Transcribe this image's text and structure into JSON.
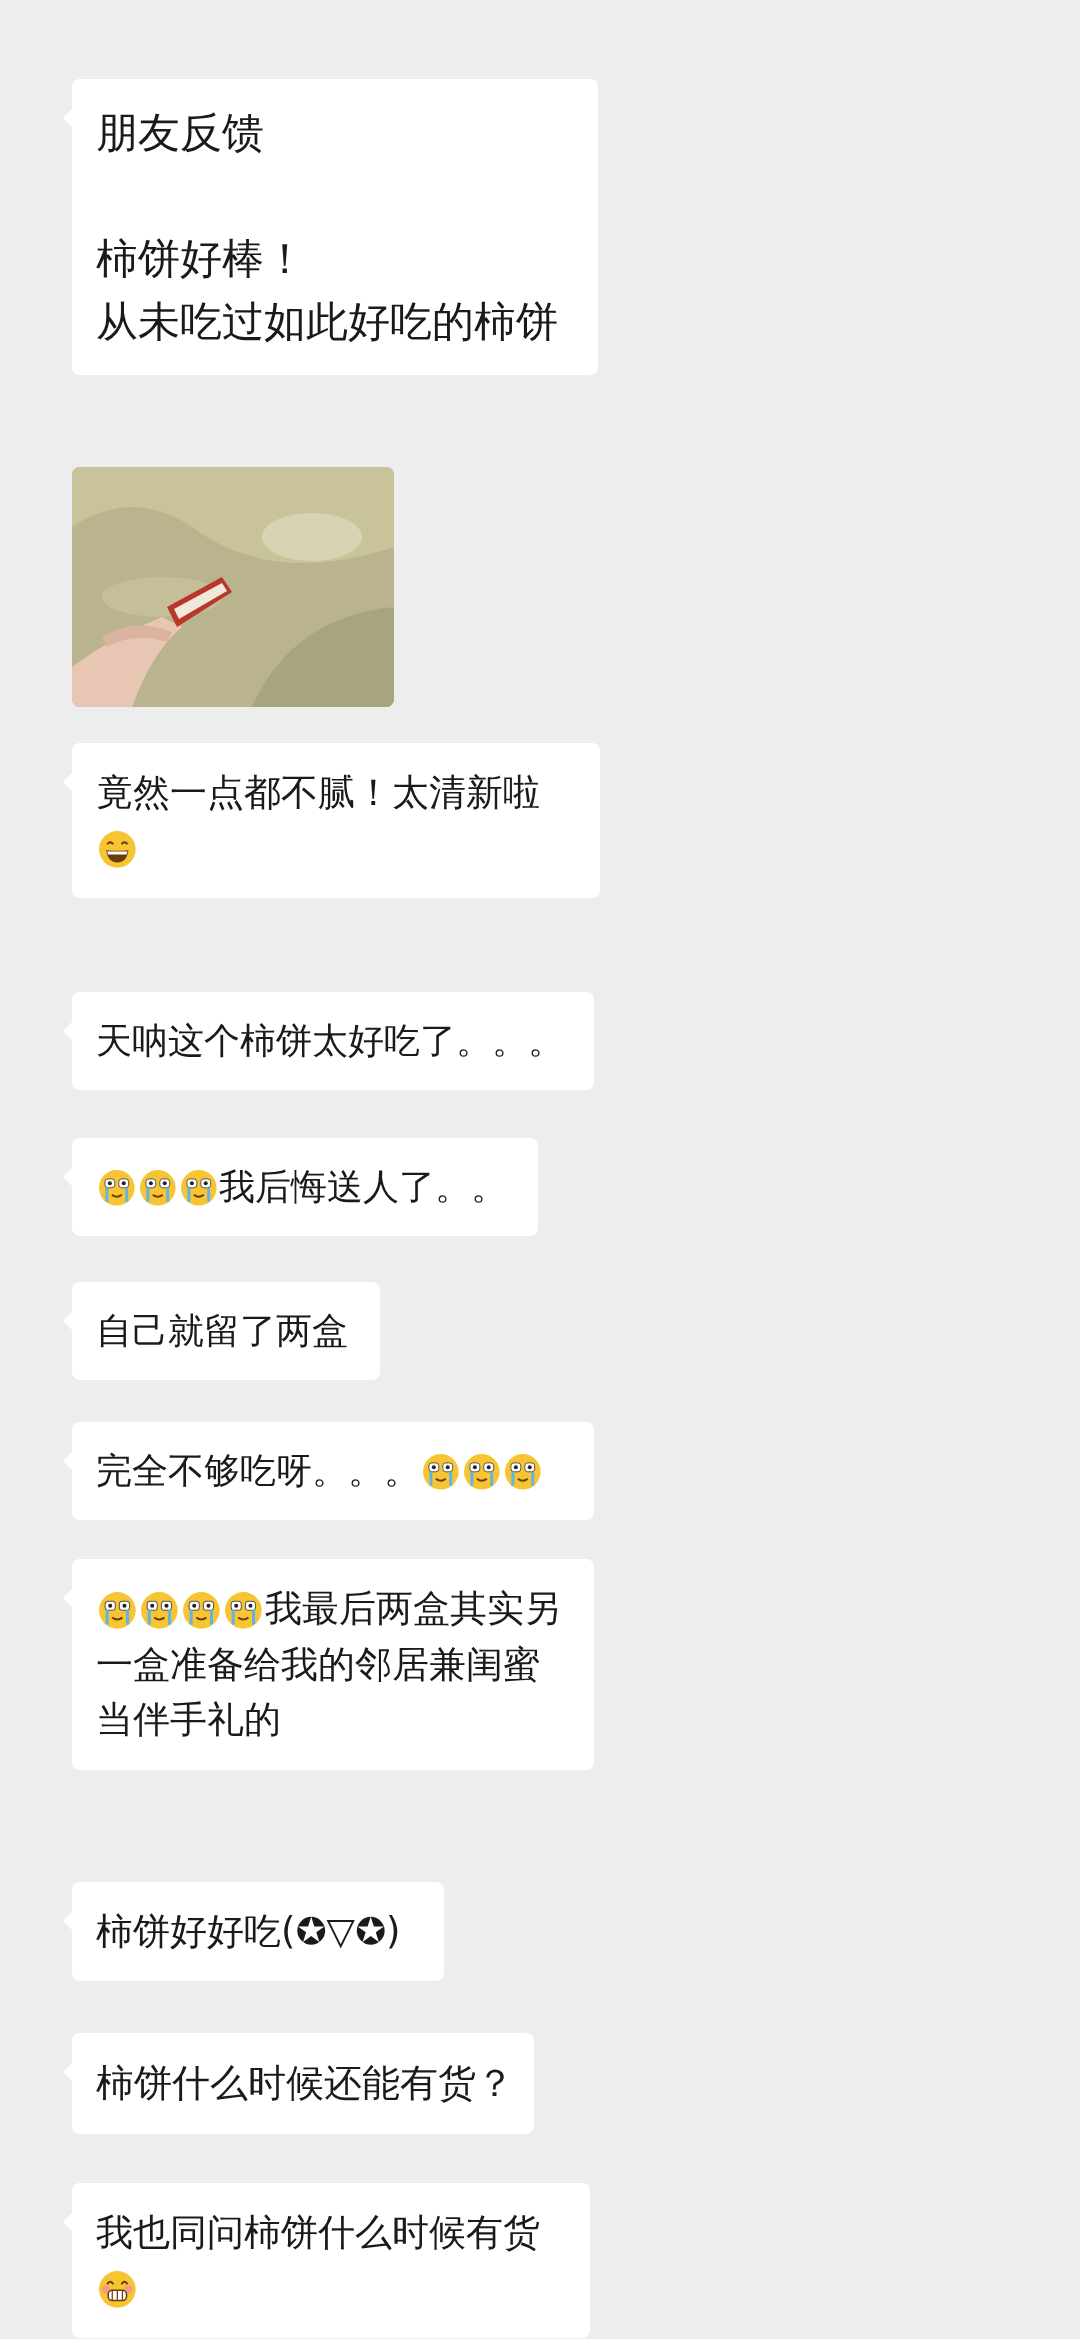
{
  "messages": [
    {
      "kind": "text",
      "parts": [
        {
          "kind": "heading",
          "text": "朋友反馈"
        },
        {
          "kind": "line",
          "text": "柿饼好棒！"
        },
        {
          "kind": "line",
          "text": "从未吃过如此好吃的柿饼"
        }
      ]
    },
    {
      "kind": "picture"
    },
    {
      "kind": "text",
      "parts": [
        {
          "kind": "text",
          "text": "竟然一点都不腻！太清新啦"
        },
        {
          "kind": "grinning"
        }
      ]
    },
    {
      "kind": "text",
      "parts": [
        {
          "kind": "text",
          "text": "天呐这个柿饼太好吃了。。。"
        }
      ]
    },
    {
      "kind": "text",
      "parts": [
        {
          "kind": "crying"
        },
        {
          "kind": "crying"
        },
        {
          "kind": "crying"
        },
        {
          "kind": "text",
          "text": "我后悔送人了。。"
        }
      ]
    },
    {
      "kind": "text",
      "parts": [
        {
          "kind": "text",
          "text": "自己就留了两盒"
        }
      ]
    },
    {
      "kind": "text",
      "parts": [
        {
          "kind": "text",
          "text": "完全不够吃呀。。。"
        },
        {
          "kind": "crying"
        },
        {
          "kind": "crying"
        },
        {
          "kind": "crying"
        }
      ]
    },
    {
      "kind": "text",
      "parts": [
        {
          "kind": "crying"
        },
        {
          "kind": "crying"
        },
        {
          "kind": "crying"
        },
        {
          "kind": "crying"
        },
        {
          "kind": "text",
          "text": "我最后两盒其实另"
        },
        {
          "kind": "line",
          "text": "一盒准备给我的邻居兼闺蜜当伴手礼的"
        }
      ]
    },
    {
      "kind": "text",
      "parts": [
        {
          "kind": "text",
          "text": "柿饼好好吃(✪▽✪)"
        }
      ]
    },
    {
      "kind": "text",
      "parts": [
        {
          "kind": "text",
          "text": "柿饼什么时候还能有货？"
        }
      ]
    },
    {
      "kind": "text",
      "parts": [
        {
          "kind": "text",
          "text": "我也同问柿饼什么时候有货"
        },
        {
          "kind": "smiling"
        }
      ]
    }
  ]
}
